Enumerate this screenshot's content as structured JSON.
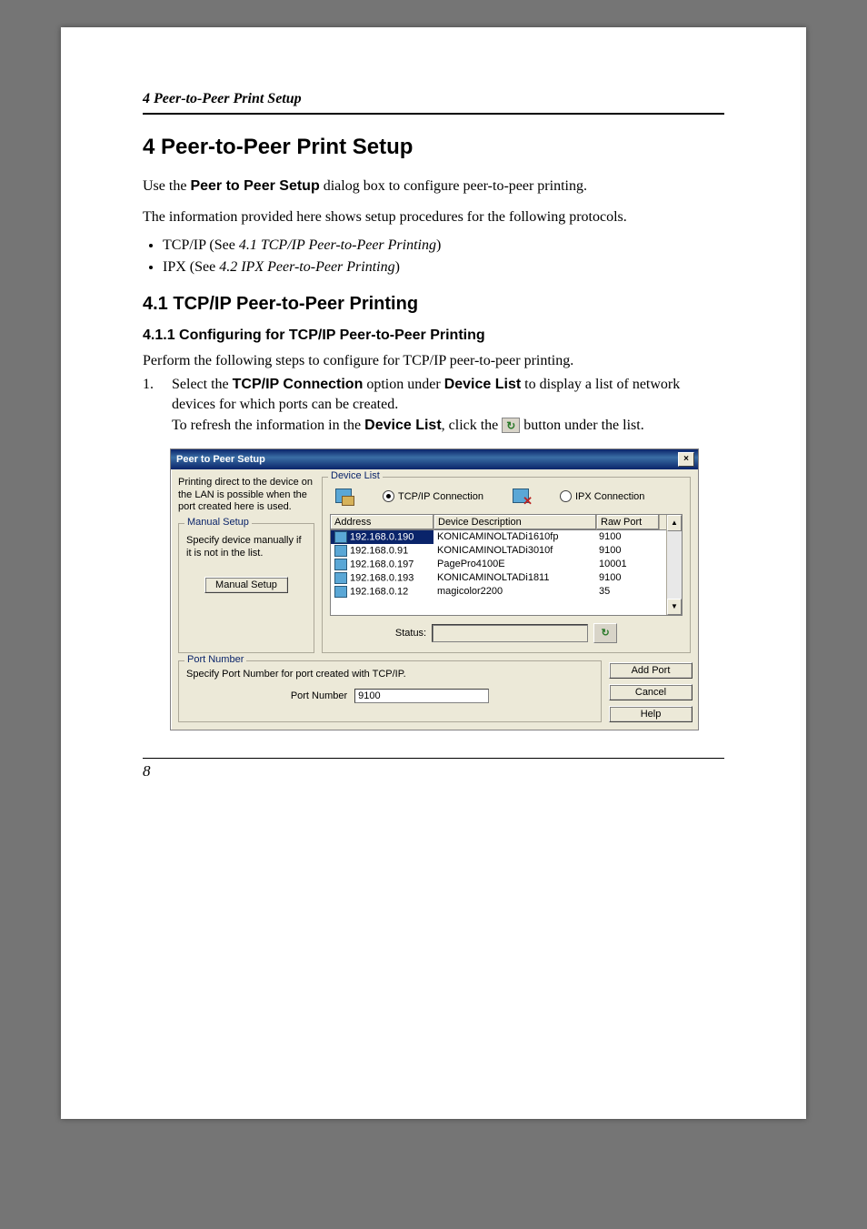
{
  "header": {
    "running": "4  Peer-to-Peer Print Setup"
  },
  "sec": {
    "title": "4  Peer-to-Peer Print Setup",
    "p1a": "Use the ",
    "p1b": "Peer to Peer Setup",
    "p1c": " dialog box to configure peer-to-peer printing.",
    "p2": "The information provided here shows setup procedures for the following protocols.",
    "b1_prefix": "TCP/IP (See ",
    "b1_ref": "4.1  TCP/IP Peer-to-Peer Printing",
    "b1_suffix": ")",
    "b2_prefix": "IPX (See ",
    "b2_ref": "4.2  IPX Peer-to-Peer Printing",
    "b2_suffix": ")"
  },
  "sub41": {
    "title": "4.1  TCP/IP Peer-to-Peer Printing",
    "h411": "4.1.1  Configuring for TCP/IP Peer-to-Peer Printing",
    "intro": "Perform the following steps to configure for TCP/IP peer-to-peer printing.",
    "step_num": "1.",
    "s1a": "Select the ",
    "s1b": "TCP/IP Connection",
    "s1c": " option under ",
    "s1d": "Device List",
    "s1e": " to display a list of network devices for which ports can be created.",
    "s2a": "To refresh the information in the ",
    "s2b": "Device List",
    "s2c": ", click the ",
    "s2d": " button under the list."
  },
  "dialog": {
    "title": "Peer to Peer Setup",
    "close": "×",
    "left": {
      "desc": "Printing direct to the device on the LAN is possible when the port created here is used.",
      "manual_legend": "Manual Setup",
      "manual_desc": "Specify device manually if it is not in the list.",
      "manual_btn": "Manual Setup"
    },
    "devlist": {
      "legend": "Device List",
      "tcp_label": "TCP/IP Connection",
      "ipx_label": "IPX Connection",
      "cols": {
        "address": "Address",
        "desc": "Device Description",
        "port": "Raw Port"
      },
      "rows": [
        {
          "addr": "192.168.0.190",
          "desc": "KONICAMINOLTADi1610fp",
          "port": "9100"
        },
        {
          "addr": "192.168.0.91",
          "desc": "KONICAMINOLTADi3010f",
          "port": "9100"
        },
        {
          "addr": "192.168.0.197",
          "desc": "PagePro4100E",
          "port": "10001"
        },
        {
          "addr": "192.168.0.193",
          "desc": "KONICAMINOLTADi1811",
          "port": "9100"
        },
        {
          "addr": "192.168.0.12",
          "desc": "magicolor2200",
          "port": "35"
        }
      ],
      "status_label": "Status:"
    },
    "portnum": {
      "legend": "Port Number",
      "desc": "Specify Port Number for port created with TCP/IP.",
      "label": "Port Number",
      "value": "9100"
    },
    "buttons": {
      "add": "Add Port",
      "cancel": "Cancel",
      "help": "Help"
    }
  },
  "pagenum": "8"
}
